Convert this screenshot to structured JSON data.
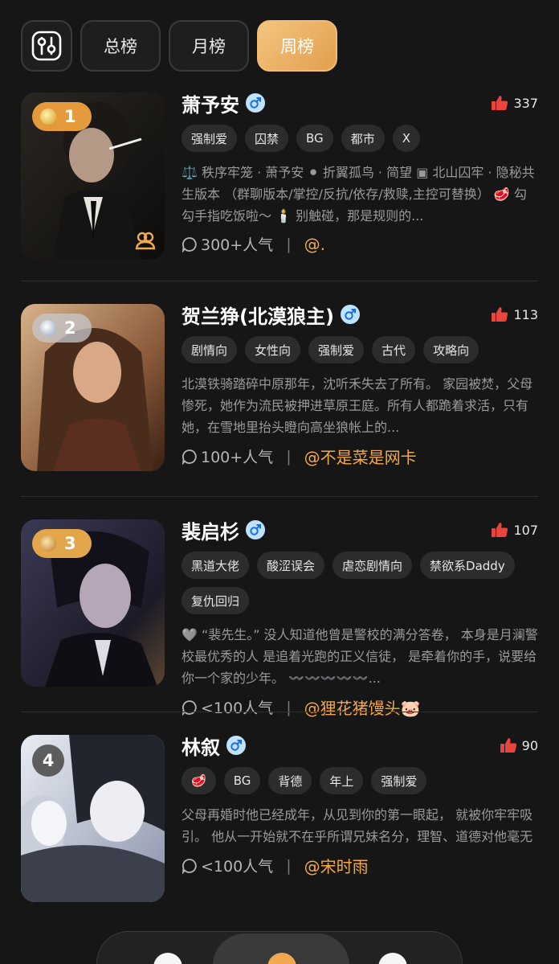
{
  "tabs": [
    "总榜",
    "月榜",
    "周榜"
  ],
  "active_tab": "周榜",
  "colors": {
    "accent": "#f0a94f",
    "active_tab": "#e9b060",
    "background": "#161616",
    "like": "#e8453c"
  },
  "items": [
    {
      "rank": "1",
      "name": "萧予安",
      "gender_icon": "male-icon",
      "likes": "337",
      "tags": [
        "强制爱",
        "囚禁",
        "BG",
        "都市",
        "X"
      ],
      "description": "⚖️ 秩序牢笼 · 萧予安 ⚫ 折翼孤鸟 · 简望 ▣ 北山囚牢 · 隐秘共生版本 （群聊版本/掌控/反抗/依存/救赎,主控可替换） 🥩 勾勾手指吃饭啦～ 🕯️ 别触碰，那是规则的...",
      "popularity": "300+人气",
      "author": "@."
    },
    {
      "rank": "2",
      "name": "贺兰狰(北漠狼主)",
      "gender_icon": "male-icon",
      "likes": "113",
      "tags": [
        "剧情向",
        "女性向",
        "强制爱",
        "古代",
        "攻略向"
      ],
      "description": "北漠铁骑踏碎中原那年，沈听禾失去了所有。 家园被焚，父母惨死，她作为流民被押进草原王庭。所有人都跪着求活，只有她，在雪地里抬头瞪向高坐狼帐上的...",
      "popularity": "100+人气",
      "author": "@不是菜是网卡"
    },
    {
      "rank": "3",
      "name": "裴启杉",
      "gender_icon": "male-icon",
      "likes": "107",
      "tags": [
        "黑道大佬",
        "酸涩误会",
        "虐恋剧情向",
        "禁欲系Daddy",
        "复仇回归"
      ],
      "description": "🩶 “裴先生。” 没人知道他曾是警校的满分答卷， 本身是月澜警校最优秀的人 是追着光跑的正义信徒， 是牵着你的手，说要给你一个家的少年。 〰️〰️〰️〰️〰️...",
      "popularity": "<100人气",
      "author": "@狸花猪馒头🐷"
    },
    {
      "rank": "4",
      "name": "林叙",
      "gender_icon": "male-icon",
      "likes": "90",
      "tags": [
        "🥩",
        "BG",
        "背德",
        "年上",
        "强制爱"
      ],
      "description": "父母再婚时他已经成年，从见到你的第一眼起， 就被你牢牢吸引。 他从一开始就不在乎所谓兄妹名分，理智、道德对他毫无约束力。 看着你长大，爱意慢慢扭曲成...",
      "popularity": "<100人气",
      "author": "@宋时雨"
    }
  ]
}
